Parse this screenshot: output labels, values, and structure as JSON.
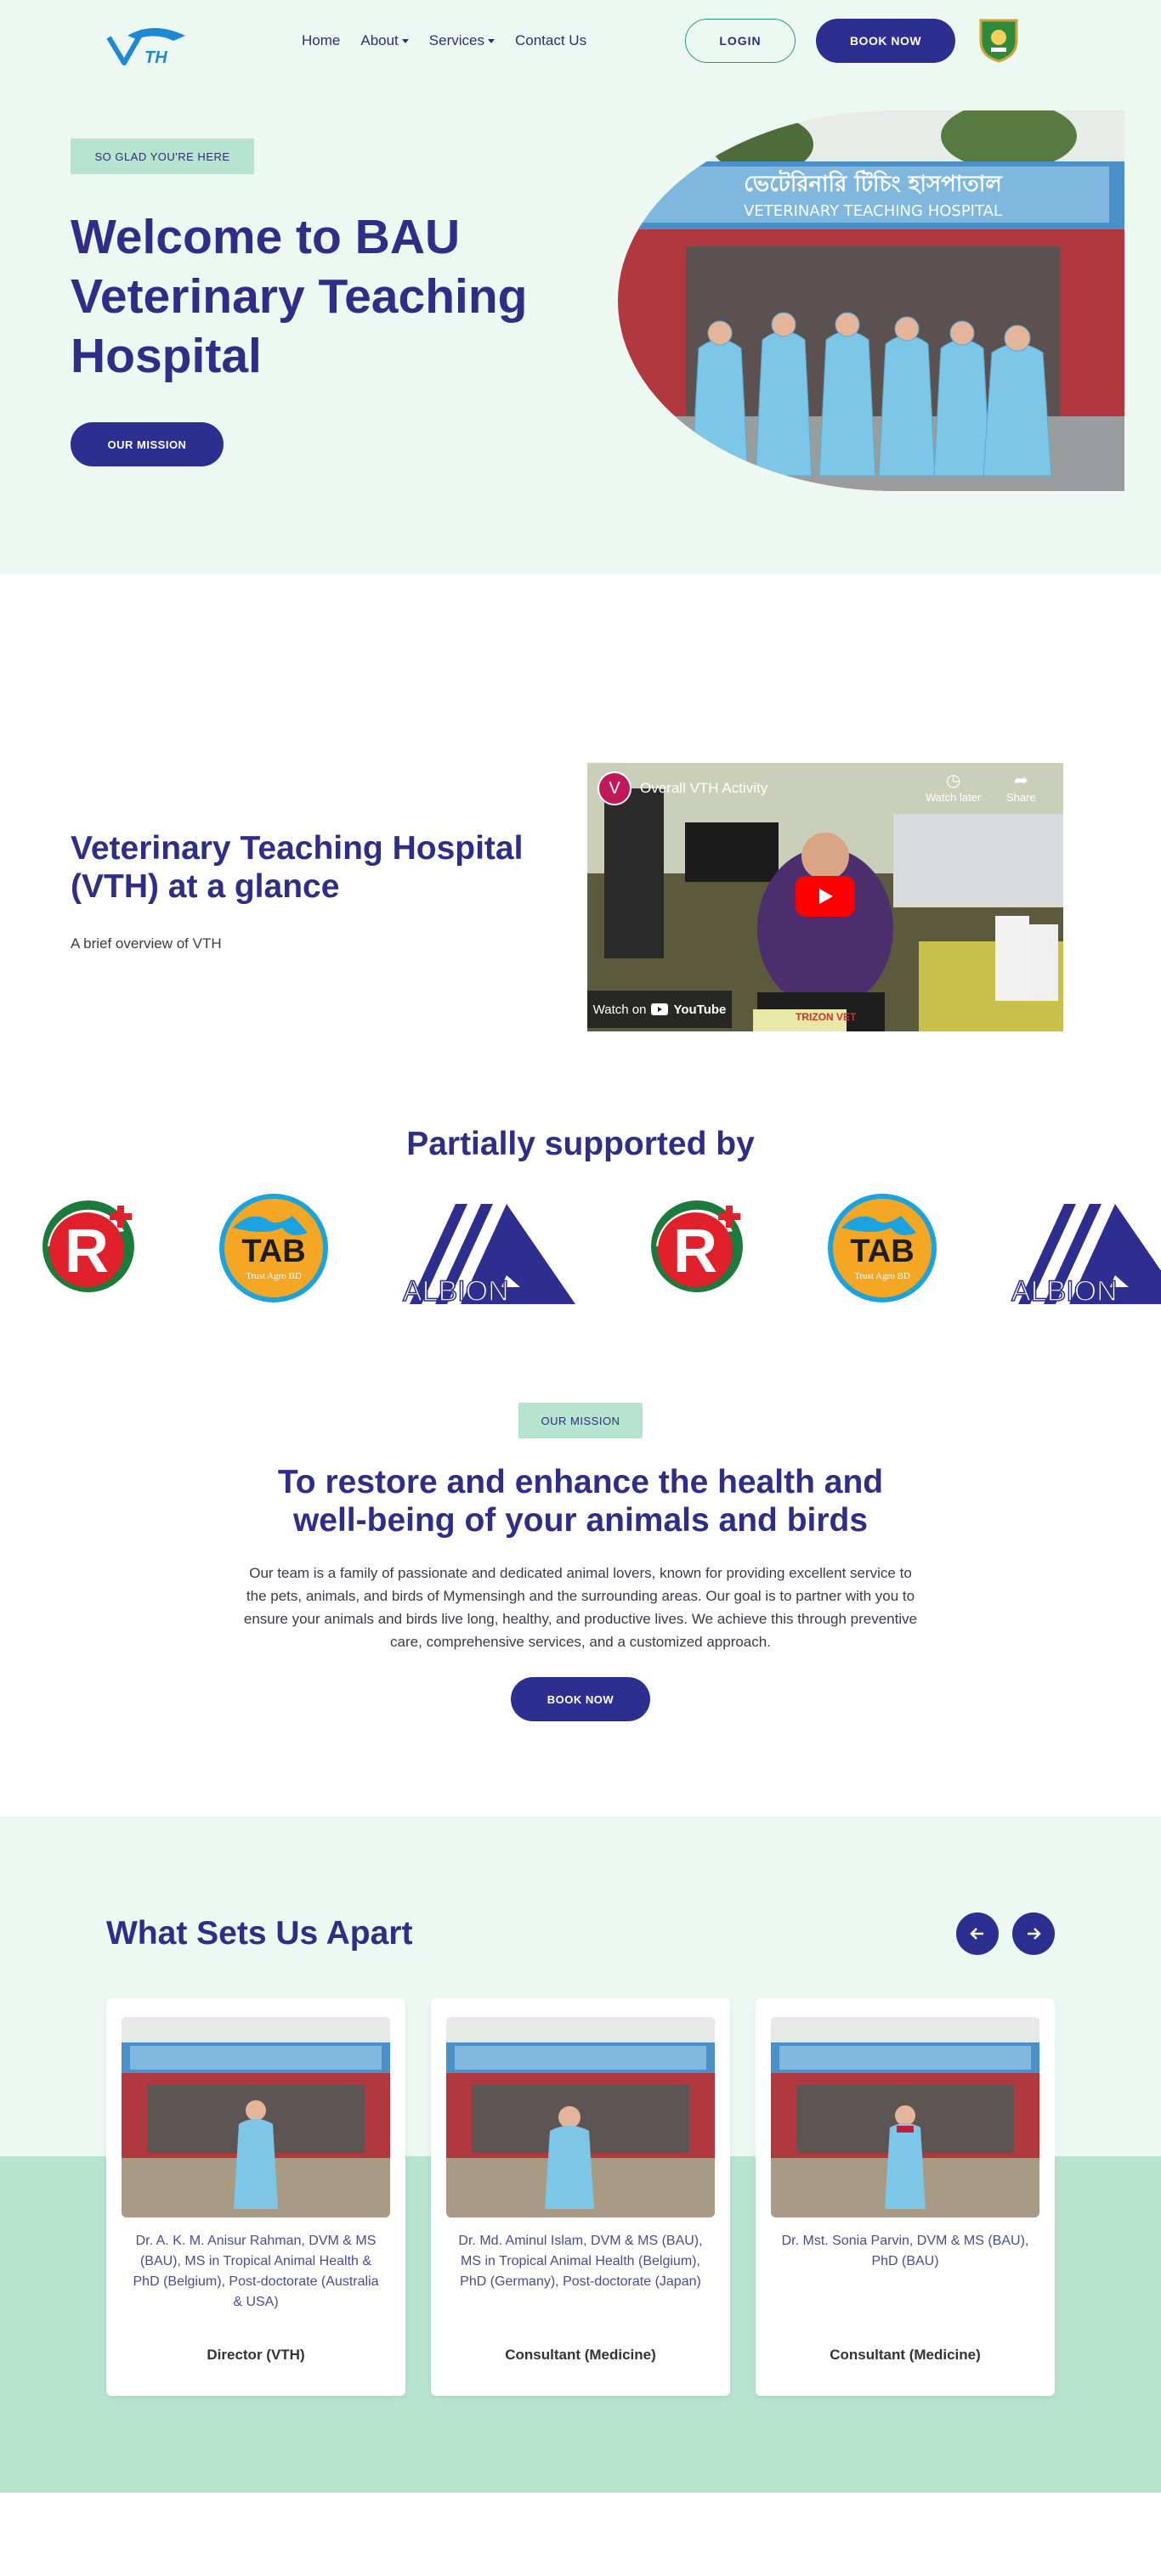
{
  "nav": {
    "logo_text": "TH",
    "menu": [
      {
        "label": "Home",
        "has_caret": false
      },
      {
        "label": "About",
        "has_caret": true
      },
      {
        "label": "Services",
        "has_caret": true
      },
      {
        "label": "Contact Us",
        "has_caret": false
      }
    ],
    "login_label": "LOGIN",
    "book_label": "BOOK NOW"
  },
  "hero": {
    "tag": "SO GLAD YOU'RE HERE",
    "title": "Welcome to BAU Veterinary Teaching Hospital",
    "button": "OUR MISSION",
    "sign_bangla": "ভেটেরিনারি টিচিং হাসপাতাল",
    "sign_english": "VETERINARY TEACHING HOSPITAL"
  },
  "glance": {
    "title": "Veterinary Teaching Hospital (VTH) at a glance",
    "subtitle": "A brief overview of VTH",
    "video": {
      "channel_initial": "V",
      "title": "Overall VTH Activity",
      "watch_later": "Watch later",
      "share": "Share",
      "watch_on": "Watch on",
      "youtube": "YouTube",
      "box_label": "TRIZON VET"
    }
  },
  "supported": {
    "title": "Partially supported by",
    "sponsors": [
      "renata",
      "tab",
      "albion",
      "renata",
      "tab",
      "albion"
    ],
    "tab_text": "TAB",
    "tab_sub": "Trust Agro BD",
    "albion_text": "ALBION"
  },
  "mission": {
    "tag": "OUR MISSION",
    "title": "To restore and enhance the health and well-being of your animals and birds",
    "text": "Our team is a family of passionate and dedicated animal lovers, known for providing excellent service to the pets, animals, and birds of Mymensingh and the surrounding areas. Our goal is to partner with you to ensure your animals and birds live long, healthy, and productive lives. We achieve this through preventive care, comprehensive services, and a customized approach.",
    "button": "BOOK NOW"
  },
  "apart": {
    "title": "What Sets Us Apart",
    "cards": [
      {
        "name": "Dr. A. K. M. Anisur Rahman, DVM & MS (BAU), MS in Tropical Animal Health & PhD (Belgium), Post-doctorate (Australia & USA)",
        "role": "Director (VTH)"
      },
      {
        "name": "Dr. Md. Aminul Islam, DVM & MS (BAU), MS in Tropical Animal Health (Belgium), PhD (Germany), Post-doctorate (Japan)",
        "role": "Consultant (Medicine)"
      },
      {
        "name": "Dr. Mst. Sonia Parvin, DVM & MS (BAU), PhD (BAU)",
        "role": "Consultant (Medicine)"
      }
    ]
  },
  "colors": {
    "brand": "#2c2f8f",
    "heading": "#2e2d88",
    "mint_light": "#eef8f2",
    "mint": "#b6e4cf"
  }
}
